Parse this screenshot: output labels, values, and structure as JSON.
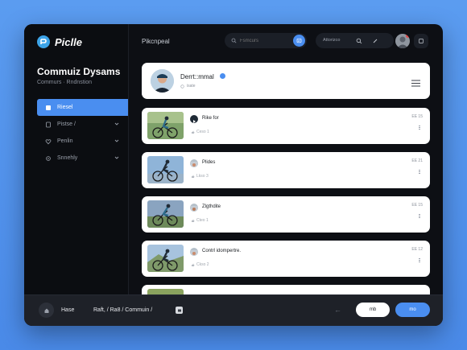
{
  "app": {
    "logo_text": "Piclle"
  },
  "sidebar": {
    "title": "Commuiz Dysams",
    "subtitle": "Commurs · Rndnstion",
    "items": [
      {
        "label": "Riesel",
        "icon": "square-icon",
        "active": true
      },
      {
        "label": "Pistse /",
        "icon": "doc-icon",
        "active": false
      },
      {
        "label": "Penlin",
        "icon": "heart-icon",
        "active": false
      },
      {
        "label": "Snnehly",
        "icon": "gear-icon",
        "active": false
      }
    ]
  },
  "topbar": {
    "heading": "Pikcnpeal",
    "search_placeholder": "Fsmcurs",
    "menu_label": "Attorizco"
  },
  "feed": {
    "header": {
      "name": "Derrt::mmal",
      "meta": "isate"
    },
    "posts": [
      {
        "title": "Rike for",
        "meta": "Ceso 1",
        "time": "EE 15"
      },
      {
        "title": "Plides",
        "meta": "Lkso 3",
        "time": "EE 21"
      },
      {
        "title": "Zlgthdite",
        "meta": "Cteo 1",
        "time": "EE 15"
      },
      {
        "title": "Contrl idompertre.",
        "meta": "Ckso 2",
        "time": "EE 12"
      }
    ]
  },
  "bottombar": {
    "home_label": "Hase",
    "breadcrumb": "Raft, / Ra8 / Commuin /",
    "back": "←",
    "button_secondary": "mb",
    "button_primary": "mo"
  },
  "colors": {
    "accent": "#4a8ef0",
    "background": "#0d0f14",
    "panel": "#1e2128",
    "logo": "#3da4e8"
  }
}
